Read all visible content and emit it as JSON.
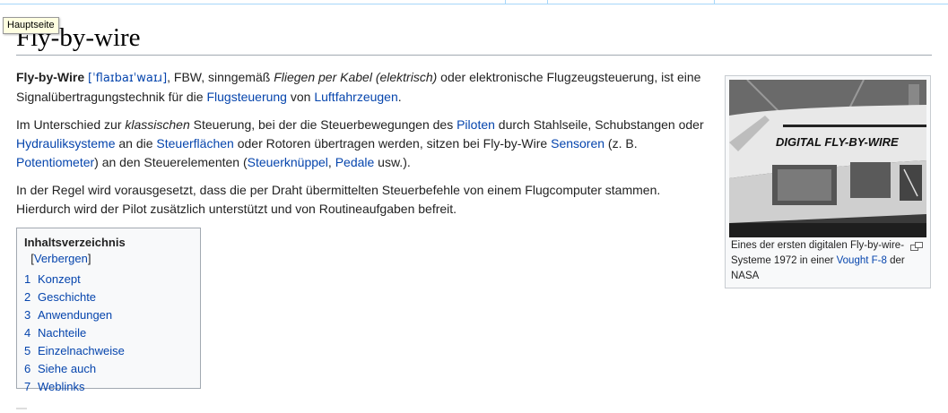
{
  "tooltip": "Hauptseite",
  "title": "Fly-by-wire",
  "intro": {
    "term": "Fly-by-Wire",
    "ipa": "[ˈflaɪbaɪˈwaɪɹ]",
    "p1a": ", FBW, sinngemäß ",
    "p1_em": "Fliegen per Kabel (elektrisch)",
    "p1b": " oder elektronische Flugzeugsteuerung, ist eine Signalübertragungstechnik für die ",
    "link_flugsteuerung": "Flugsteuerung",
    "p1c": " von ",
    "link_luftfahrzeugen": "Luftfahrzeugen",
    "p1d": "."
  },
  "para2": {
    "a": "Im Unterschied zur ",
    "em": "klassischen",
    "b": " Steuerung, bei der die Steuerbewegungen des ",
    "link_piloten": "Piloten",
    "c": " durch Stahlseile, Schubstangen oder ",
    "link_hydraulik": "Hydrauliksysteme",
    "d": " an die ",
    "link_steuerflaechen": "Steuerflächen",
    "e": " oder Rotoren übertragen werden, sitzen bei Fly-by-Wire ",
    "link_sensoren": "Sensoren",
    "f": " (z. B. ",
    "link_potentiometer": "Potentiometer",
    "g": ") an den Steuerelementen (",
    "link_steuerknueppel": "Steuerknüppel",
    "h": ", ",
    "link_pedale": "Pedale",
    "i": " usw.)."
  },
  "para3": "In der Regel wird vorausgesetzt, dass die per Draht übermittelten Steuerbefehle von einem Flugcomputer stammen. Hierdurch wird der Pilot zusätzlich unterstützt und von Routineaufgaben befreit.",
  "toc": {
    "heading": "Inhaltsverzeichnis",
    "bracket_open": "[",
    "toggle": "Verbergen",
    "bracket_close": "]",
    "items": [
      {
        "num": "1",
        "label": "Konzept"
      },
      {
        "num": "2",
        "label": "Geschichte"
      },
      {
        "num": "3",
        "label": "Anwendungen"
      },
      {
        "num": "4",
        "label": "Nachteile"
      },
      {
        "num": "5",
        "label": "Einzelnachweise"
      },
      {
        "num": "6",
        "label": "Siehe auch"
      },
      {
        "num": "7",
        "label": "Weblinks"
      }
    ]
  },
  "thumb": {
    "image_text": "DIGITAL FLY-BY-WIRE",
    "caption_a": "Eines der ersten digitalen Fly-by-wire-Systeme 1972 in einer ",
    "caption_link": "Vought F-8",
    "caption_b": " der NASA"
  }
}
